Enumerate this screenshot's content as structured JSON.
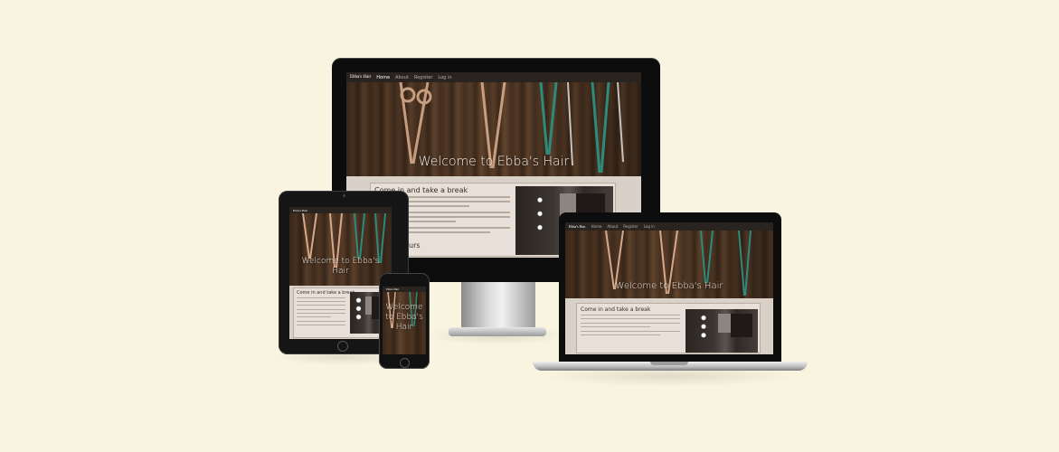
{
  "site": {
    "brand": "Ebba's Hair",
    "nav_links": [
      "Home",
      "About",
      "Register",
      "Log in"
    ]
  },
  "hero": {
    "title": "Welcome to Ebba's Hair"
  },
  "intro": {
    "heading": "Come in and take a break"
  },
  "partial_heading": "urs",
  "colors": {
    "background": "#f9f4df",
    "nav": "#2a2420",
    "card": "#e7dfd8"
  },
  "devices": [
    "desktop-monitor",
    "tablet",
    "phone",
    "laptop"
  ]
}
